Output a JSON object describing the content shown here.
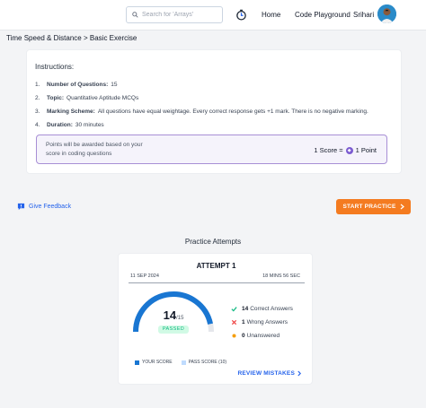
{
  "header": {
    "search_placeholder": "Search for 'Arrays'",
    "nav": {
      "home": "Home",
      "code_playground": "Code Playground"
    },
    "user_name": "Srihari"
  },
  "breadcrumb": {
    "parent": "Time Speed & Distance",
    "separator": ">",
    "current": "Basic Exercise"
  },
  "instructions": {
    "title": "Instructions:",
    "items": [
      {
        "num": "1.",
        "label": "Number of Questions:",
        "value": "15"
      },
      {
        "num": "2.",
        "label": "Topic:",
        "value": "Quantitative Aptitude MCQs"
      },
      {
        "num": "3.",
        "label": "Marking Scheme:",
        "value": "All questions have equal weightage. Every correct response gets +1 mark. There is no negative marking."
      },
      {
        "num": "4.",
        "label": "Duration:",
        "value": "30 minutes"
      }
    ],
    "points_text": "Points will be awarded based on your score in coding questions",
    "score_left": "1 Score =",
    "score_right": "1 Point"
  },
  "actions": {
    "feedback": "Give Feedback",
    "start_practice": "START PRACTICE"
  },
  "attempts": {
    "section_title": "Practice Attempts",
    "attempt_title": "ATTEMPT 1",
    "date": "11 SEP 2024",
    "duration": "18 MINS 56 SEC",
    "score": "14",
    "total": "/15",
    "score_fraction": 0.933,
    "status": "PASSED",
    "stats": [
      {
        "count": "14",
        "label": "Correct Answers",
        "kind": "correct",
        "color": "#10b981"
      },
      {
        "count": "1",
        "label": "Wrong Answers",
        "kind": "wrong",
        "color": "#ef4444"
      },
      {
        "count": "0",
        "label": "Unanswered",
        "kind": "unanswered",
        "color": "#f59e0b"
      }
    ],
    "legend_your_score": "YOUR SCORE",
    "legend_pass_score": "PASS SCORE (10)",
    "review": "REVIEW MISTAKES",
    "colors": {
      "gauge": "#1976d2",
      "pass": "#bfdbfe",
      "track": "#e5e7eb"
    }
  },
  "colors": {
    "accent": "#f47b20",
    "link": "#2563eb",
    "purple": "#7c5cd1"
  }
}
